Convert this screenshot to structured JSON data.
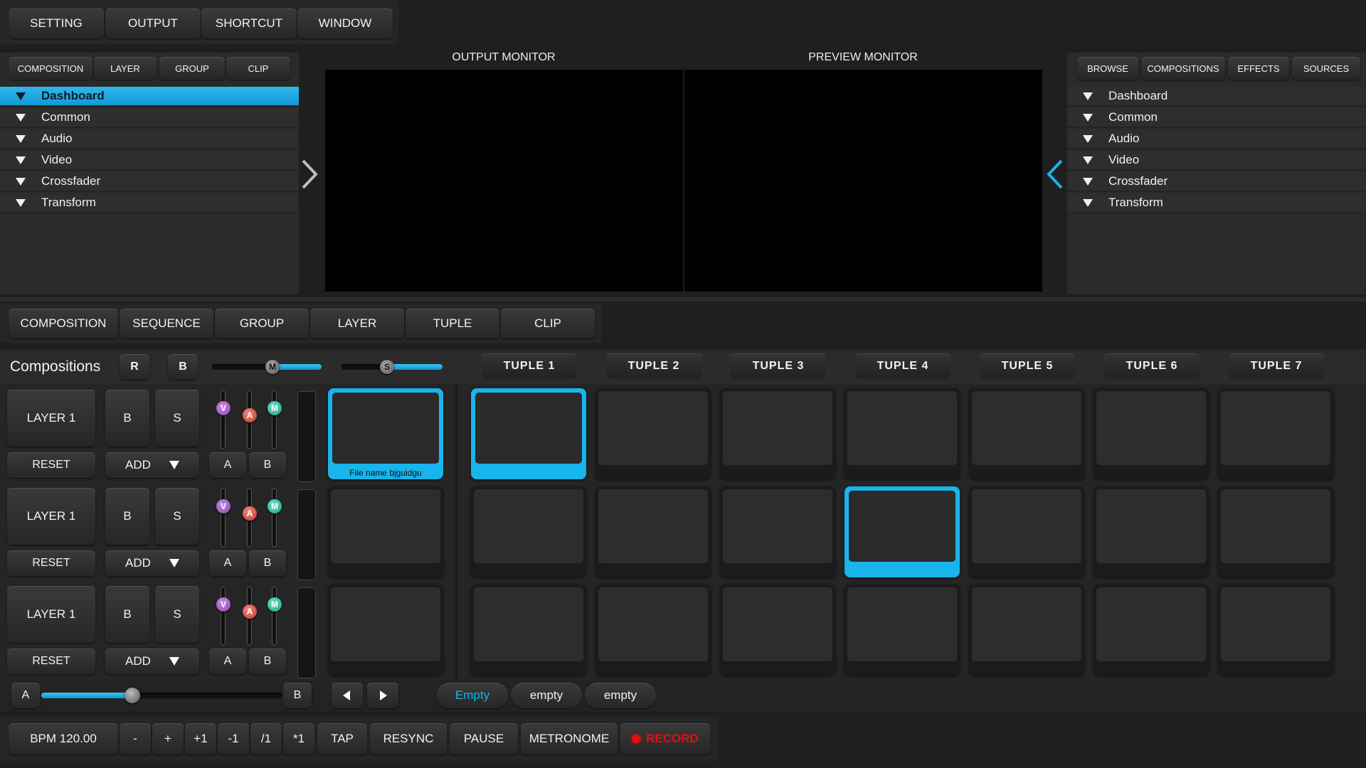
{
  "menubar": {
    "items": [
      "SETTING",
      "OUTPUT",
      "SHORTCUT",
      "WINDOW"
    ]
  },
  "left_panel": {
    "tabs": [
      "COMPOSITION",
      "LAYER",
      "GROUP",
      "CLIP"
    ],
    "items": [
      "Dashboard",
      "Common",
      "Audio",
      "Video",
      "Crossfader",
      "Transform"
    ],
    "selected": "Dashboard"
  },
  "monitors": {
    "output_title": "OUTPUT MONITOR",
    "preview_title": "PREVIEW MONITOR"
  },
  "right_panel": {
    "tabs": [
      "BROWSE",
      "COMPOSITIONS",
      "EFFECTS",
      "SOURCES"
    ],
    "items": [
      "Dashboard",
      "Common",
      "Audio",
      "Video",
      "Crossfader",
      "Transform"
    ]
  },
  "mode_tabs": [
    "COMPOSITION",
    "SEQUENCE",
    "GROUP",
    "LAYER",
    "TUPLE",
    "CLIP"
  ],
  "compositions": {
    "title": "Compositions",
    "r_label": "R",
    "b_label": "B",
    "m_label": "M",
    "s_label": "S",
    "m_slider_level": 0.55,
    "s_slider_level": 0.45
  },
  "tuples": [
    "TUPLE 1",
    "TUPLE 2",
    "TUPLE 3",
    "TUPLE 4",
    "TUPLE 5",
    "TUPLE 6",
    "TUPLE 7"
  ],
  "layers": [
    {
      "name": "LAYER 1",
      "b": "B",
      "s": "S",
      "reset": "RESET",
      "add": "ADD",
      "a": "A",
      "bb": "B",
      "v": "V",
      "am": "A",
      "m": "M"
    },
    {
      "name": "LAYER 1",
      "b": "B",
      "s": "S",
      "reset": "RESET",
      "add": "ADD",
      "a": "A",
      "bb": "B",
      "v": "V",
      "am": "A",
      "m": "M"
    },
    {
      "name": "LAYER 1",
      "b": "B",
      "s": "S",
      "reset": "RESET",
      "add": "ADD",
      "a": "A",
      "bb": "B",
      "v": "V",
      "am": "A",
      "m": "M"
    }
  ],
  "preview_clip": {
    "file_name": "File name bjguidgu"
  },
  "selected_cells": [
    {
      "row": 0,
      "col": 0
    },
    {
      "row": 1,
      "col": 3
    }
  ],
  "crossfader": {
    "left_label": "A",
    "right_label": "B",
    "position": 0.38
  },
  "clip_slots": [
    "Empty",
    "empty",
    "empty"
  ],
  "transport": {
    "bpm": "BPM 120.00",
    "buttons": [
      "-",
      "+",
      "+1",
      "-1",
      "/1",
      "*1",
      "TAP",
      "RESYNC",
      "PAUSE",
      "METRONOME"
    ],
    "record": "RECORD"
  },
  "colors": {
    "accent": "#19b4ec",
    "record": "#e01010",
    "knob_v": "#8e44ad",
    "knob_a": "#c0392b",
    "knob_m": "#16a085"
  }
}
